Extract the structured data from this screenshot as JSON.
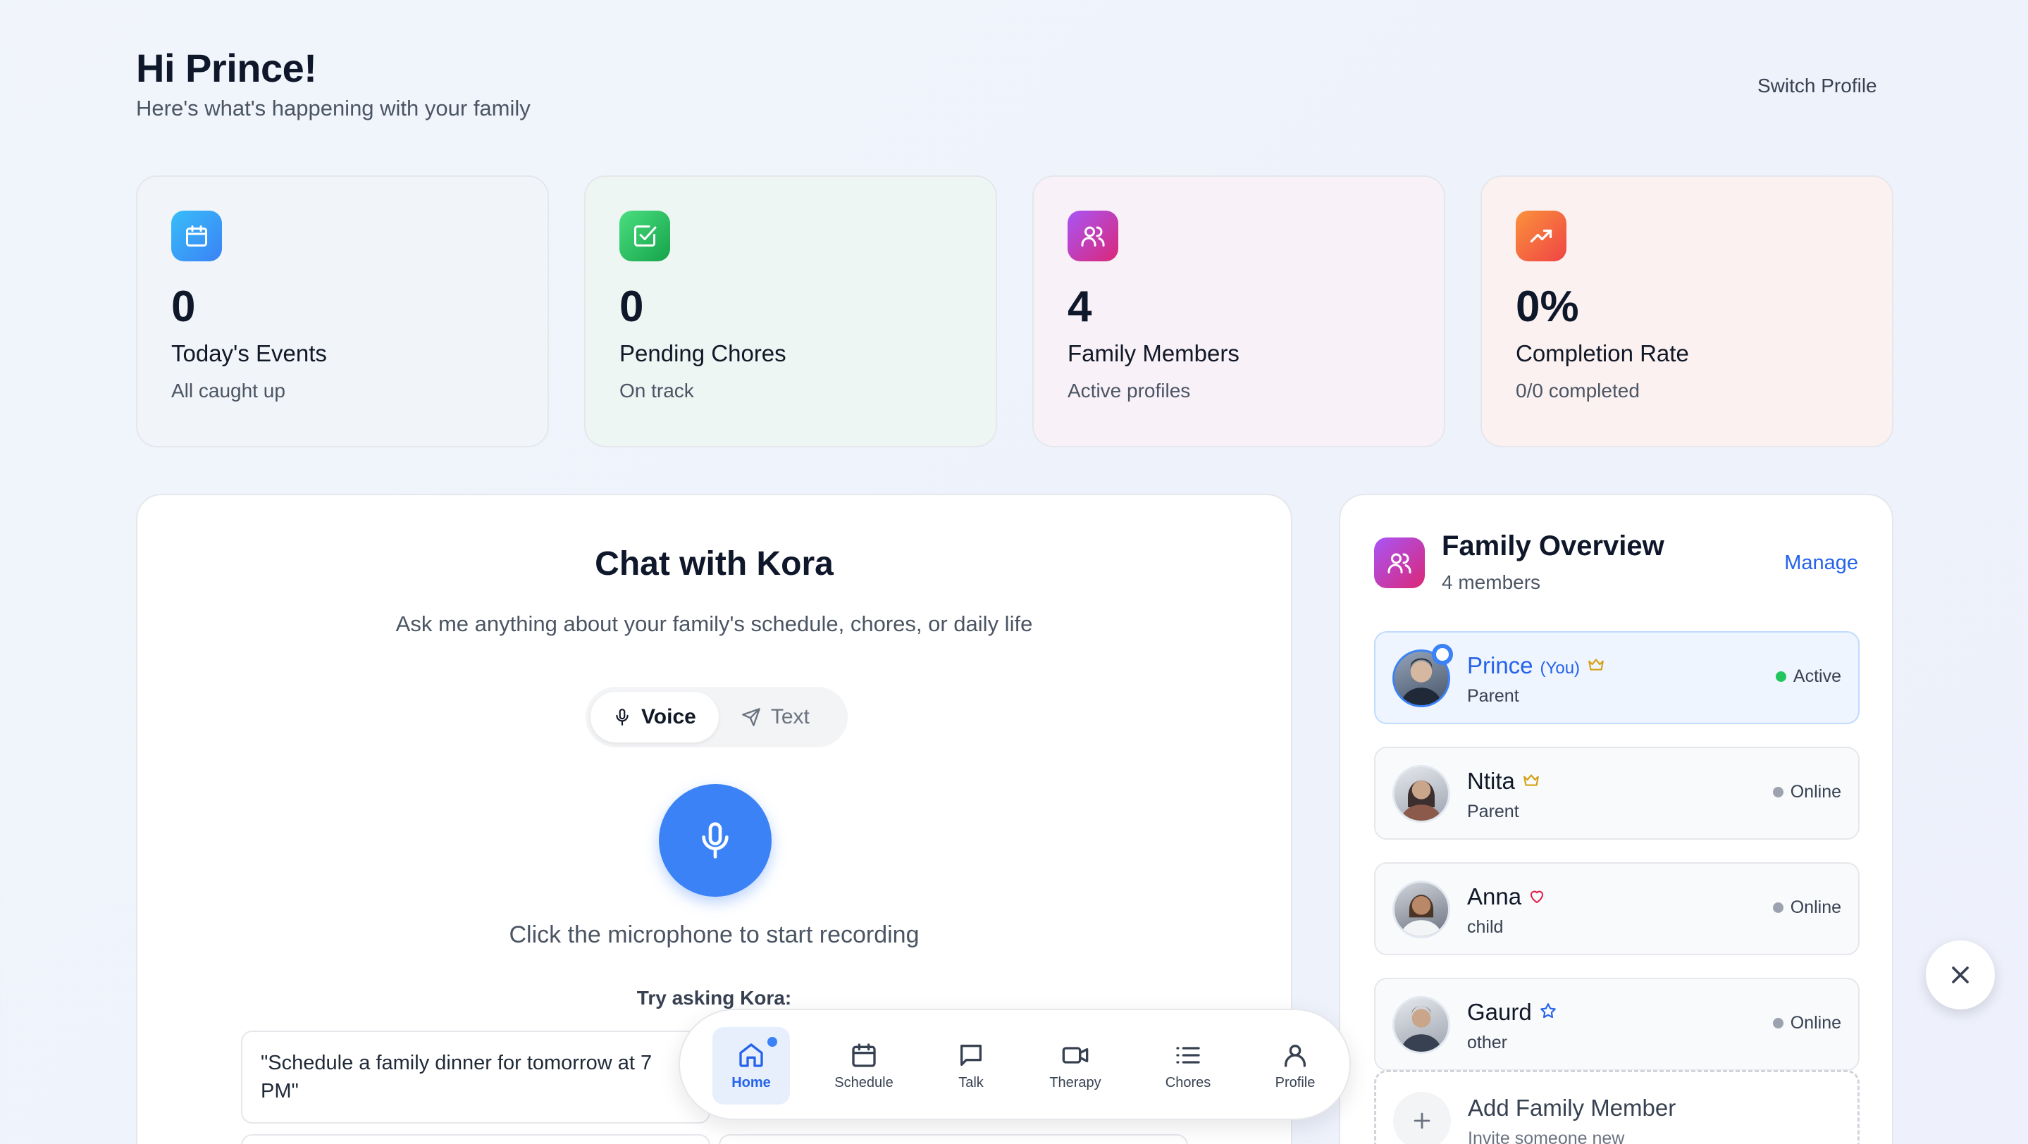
{
  "header": {
    "greeting": "Hi Prince!",
    "subtitle": "Here's what's happening with your family",
    "switch_profile": "Switch Profile"
  },
  "stats": [
    {
      "value": "0",
      "label": "Today's Events",
      "sub": "All caught up",
      "icon": "calendar-icon",
      "color": "#3b82f6"
    },
    {
      "value": "0",
      "label": "Pending Chores",
      "sub": "On track",
      "icon": "check-square-icon",
      "color": "#22c55e"
    },
    {
      "value": "4",
      "label": "Family Members",
      "sub": "Active profiles",
      "icon": "users-icon",
      "color": "#c026d3"
    },
    {
      "value": "0%",
      "label": "Completion Rate",
      "sub": "0/0 completed",
      "icon": "trending-up-icon",
      "color": "#f97316"
    }
  ],
  "chat": {
    "title": "Chat with Kora",
    "subtitle": "Ask me anything about your family's schedule, chores, or daily life",
    "mode_voice": "Voice",
    "mode_text": "Text",
    "mic_hint": "Click the microphone to start recording",
    "try_label": "Try asking Kora:",
    "suggestion_1": "\"Schedule a family dinner for tomorrow at 7 PM\""
  },
  "family": {
    "title": "Family Overview",
    "count": "4 members",
    "manage": "Manage",
    "members": [
      {
        "name": "Prince",
        "you": "(You)",
        "role": "Parent",
        "status": "Active",
        "badge": "crown-icon",
        "status_color": "#22c55e"
      },
      {
        "name": "Ntita",
        "role": "Parent",
        "status": "Online",
        "badge": "crown-icon",
        "status_color": "#9ca3af"
      },
      {
        "name": "Anna",
        "role": "child",
        "status": "Online",
        "badge": "heart-icon",
        "status_color": "#9ca3af"
      },
      {
        "name": "Gaurd",
        "role": "other",
        "status": "Online",
        "badge": "star-icon",
        "status_color": "#9ca3af"
      }
    ],
    "add_title": "Add Family Member",
    "add_sub": "Invite someone new"
  },
  "nav": {
    "items": [
      {
        "label": "Home",
        "icon": "home-icon",
        "active": true
      },
      {
        "label": "Schedule",
        "icon": "calendar-icon"
      },
      {
        "label": "Talk",
        "icon": "message-icon"
      },
      {
        "label": "Therapy",
        "icon": "video-icon"
      },
      {
        "label": "Chores",
        "icon": "list-icon"
      },
      {
        "label": "Profile",
        "icon": "user-icon"
      }
    ]
  }
}
